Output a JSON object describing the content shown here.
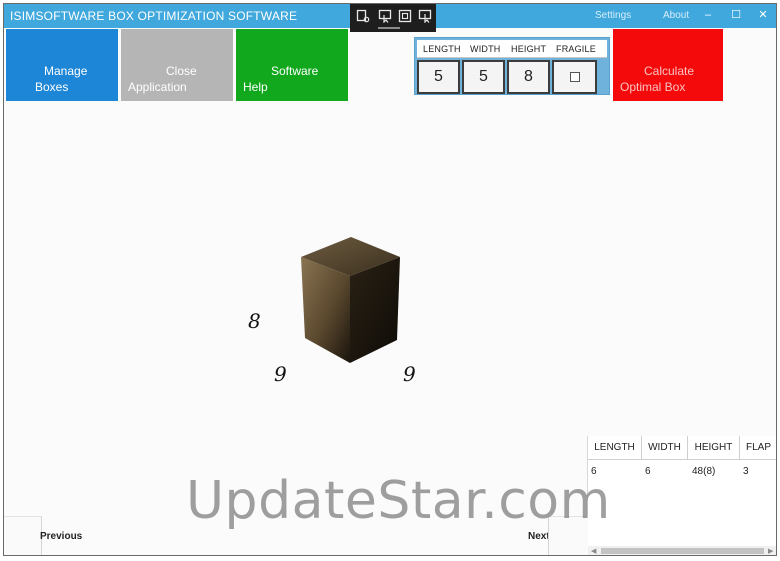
{
  "window": {
    "title": "ISIMSOFTWARE BOX OPTIMIZATION SOFTWARE",
    "settings_label": "Settings",
    "about_label": "About",
    "minimize_glyph": "–",
    "maximize_glyph": "☐",
    "close_glyph": "✕"
  },
  "capture_toolbar": {
    "icons": [
      "capture-settings-icon",
      "region-capture-icon",
      "window-capture-icon",
      "cursor-capture-icon"
    ]
  },
  "tiles": {
    "manage": {
      "line1": "Manage",
      "line2": "Boxes",
      "color": "#1e86d6"
    },
    "close": {
      "line1": "Close",
      "line2": "Application",
      "color": "#b5b5b5"
    },
    "help": {
      "line1": "Software",
      "line2": "Help",
      "color": "#12a81e"
    },
    "calculate": {
      "line1": "Calculate",
      "line2": "Optimal Box",
      "color": "#f40a0a"
    }
  },
  "inputs": {
    "headers": [
      "LENGTH",
      "WIDTH",
      "HEIGHT",
      "FRAGILE"
    ],
    "length": "5",
    "width": "5",
    "height": "8",
    "fragile": false
  },
  "preview": {
    "height_label": "8",
    "length_label": "9",
    "width_label": "9"
  },
  "results": {
    "headers": [
      "LENGTH",
      "WIDTH",
      "HEIGHT",
      "FLAP"
    ],
    "rows": [
      {
        "length": "6",
        "width": "6",
        "height": "48(8)",
        "flap": "3"
      }
    ]
  },
  "nav": {
    "previous": "Previous",
    "next": "Next"
  },
  "watermark": "UpdateStar.com"
}
